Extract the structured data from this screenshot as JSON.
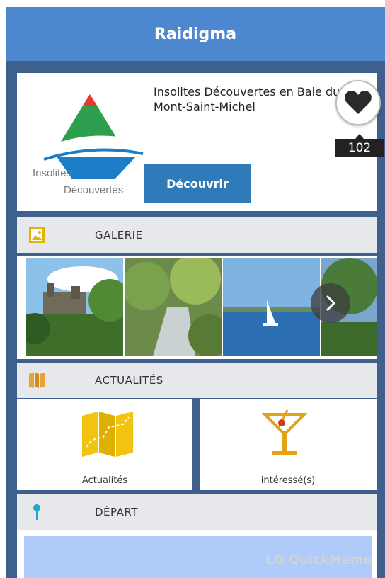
{
  "header": {
    "title": "Raidigma"
  },
  "hero": {
    "title": "Insolites Découvertes en Baie du Mont-Saint-Michel",
    "logo_line1": "Insolites",
    "logo_line2": "Découvertes",
    "discover_label": "Découvrir",
    "favorite_icon": "heart-icon",
    "favorite_count": "102"
  },
  "sections": {
    "gallery": {
      "label": "GALERIE",
      "icon": "image-icon"
    },
    "news": {
      "label": "ACTUALITÉS",
      "icon": "map-icon"
    },
    "departure": {
      "label": "DÉPART",
      "icon": "pin-icon"
    }
  },
  "tiles": {
    "news": {
      "caption": "Actualités",
      "icon": "folded-map-icon"
    },
    "interested": {
      "caption": "intéressé(s)",
      "icon": "cocktail-icon"
    }
  },
  "watermark": "LG QuickMemo",
  "colors": {
    "topbar": "#4d87cf",
    "background": "#3f5f8c",
    "button": "#2f7ab8",
    "icon_gold": "#e4b400"
  }
}
